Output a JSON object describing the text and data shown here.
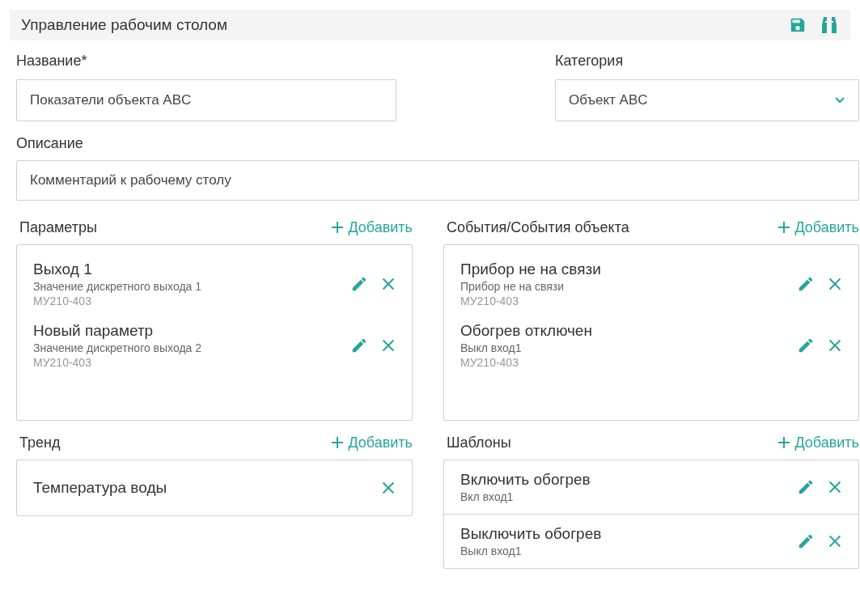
{
  "header": {
    "title": "Управление рабочим столом"
  },
  "name_field": {
    "label": "Название*",
    "value": "Показатели объекта ABC"
  },
  "category_field": {
    "label": "Категория",
    "value": "Объект ABC"
  },
  "description_field": {
    "label": "Описание",
    "value": "Комментарий к рабочему столу"
  },
  "sections": [
    {
      "title": "Параметры",
      "add_label": "Добавить",
      "divided": false,
      "items": [
        {
          "title": "Выход 1",
          "subtitle": "Значение дискретного выхода 1",
          "device": "МУ210-403",
          "editable": true
        },
        {
          "title": "Новый параметр",
          "subtitle": "Значение дискретного выхода 2",
          "device": "МУ210-403",
          "editable": true
        }
      ]
    },
    {
      "title": "События/События объекта",
      "add_label": "Добавить",
      "divided": false,
      "items": [
        {
          "title": "Прибор не на связи",
          "subtitle": "Прибор не на связи",
          "device": "МУ210-403",
          "editable": true
        },
        {
          "title": "Обогрев отключен",
          "subtitle": "Выкл вход1",
          "device": "МУ210-403",
          "editable": true
        }
      ]
    },
    {
      "title": "Тренд",
      "add_label": "Добавить",
      "divided": false,
      "items": [
        {
          "title": "Температура воды",
          "editable": false
        }
      ]
    },
    {
      "title": "Шаблоны",
      "add_label": "Добавить",
      "divided": true,
      "items": [
        {
          "title": "Включить обогрев",
          "subtitle": "Вкл вход1",
          "editable": true
        },
        {
          "title": "Выключить обогрев",
          "subtitle": "Выкл вход1",
          "editable": true
        }
      ]
    }
  ]
}
